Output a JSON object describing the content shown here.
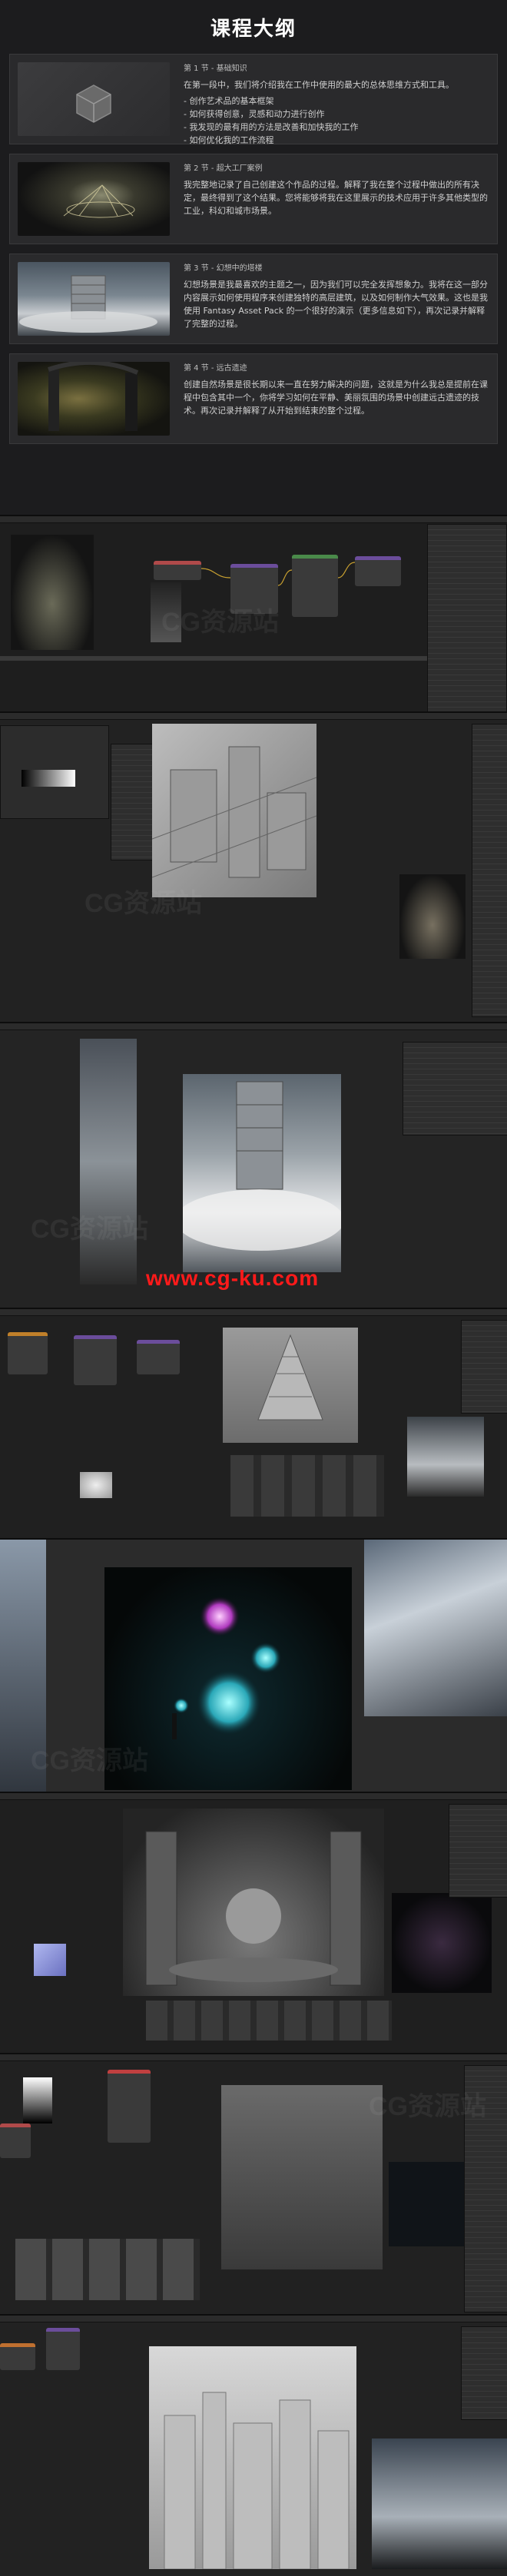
{
  "page": {
    "title": "课程大纲"
  },
  "sections": [
    {
      "num": "第 1 节 - 基础知识",
      "desc": "在第一段中，我们将介绍我在工作中使用的最大的总体思维方式和工具。",
      "bullets": [
        "- 创作艺术品的基本框架",
        "- 如何获得创意，灵感和动力进行创作",
        "- 我发现的最有用的方法是改善和加快我的工作",
        "- 如何优化我的工作流程"
      ]
    },
    {
      "num": "第 2 节 - 超大工厂案例",
      "desc": "我完整地记录了自己创建这个作品的过程。解释了我在整个过程中做出的所有决定，最终得到了这个结果。您将能够将我在这里展示的技术应用于许多其他类型的工业，科幻和城市场景。",
      "bullets": []
    },
    {
      "num": "第 3 节 - 幻想中的塔楼",
      "desc": "幻想场景是我最喜欢的主题之一，因为我们可以完全发挥想象力。我将在这一部分内容展示如何使用程序来创建独特的高层建筑，以及如何制作大气效果。这也是我使用 Fantasy Asset Pack 的一个很好的演示（更多信息如下），再次记录并解释了完整的过程。",
      "bullets": []
    },
    {
      "num": "第 4 节 - 远古遗迹",
      "desc": "创建自然场景是很长期以来一直在努力解决的问题，这就是为什么我总是提前在课程中包含其中一个，你将学习如何在平静、美丽氛围的场景中创建远古遗迹的技术。再次记录并解释了从开始到结束的整个过程。",
      "bullets": []
    }
  ],
  "watermarks": {
    "small": "CG资源站",
    "url": "www.cg-ku.com"
  },
  "icons": [
    "cube-icon",
    "node-icon",
    "outliner-icon",
    "properties-icon",
    "timeline-icon"
  ],
  "colors": {
    "accent": "#6b4d9b",
    "watermark_red": "#ff1a1a",
    "background": "#1c1c1e"
  }
}
